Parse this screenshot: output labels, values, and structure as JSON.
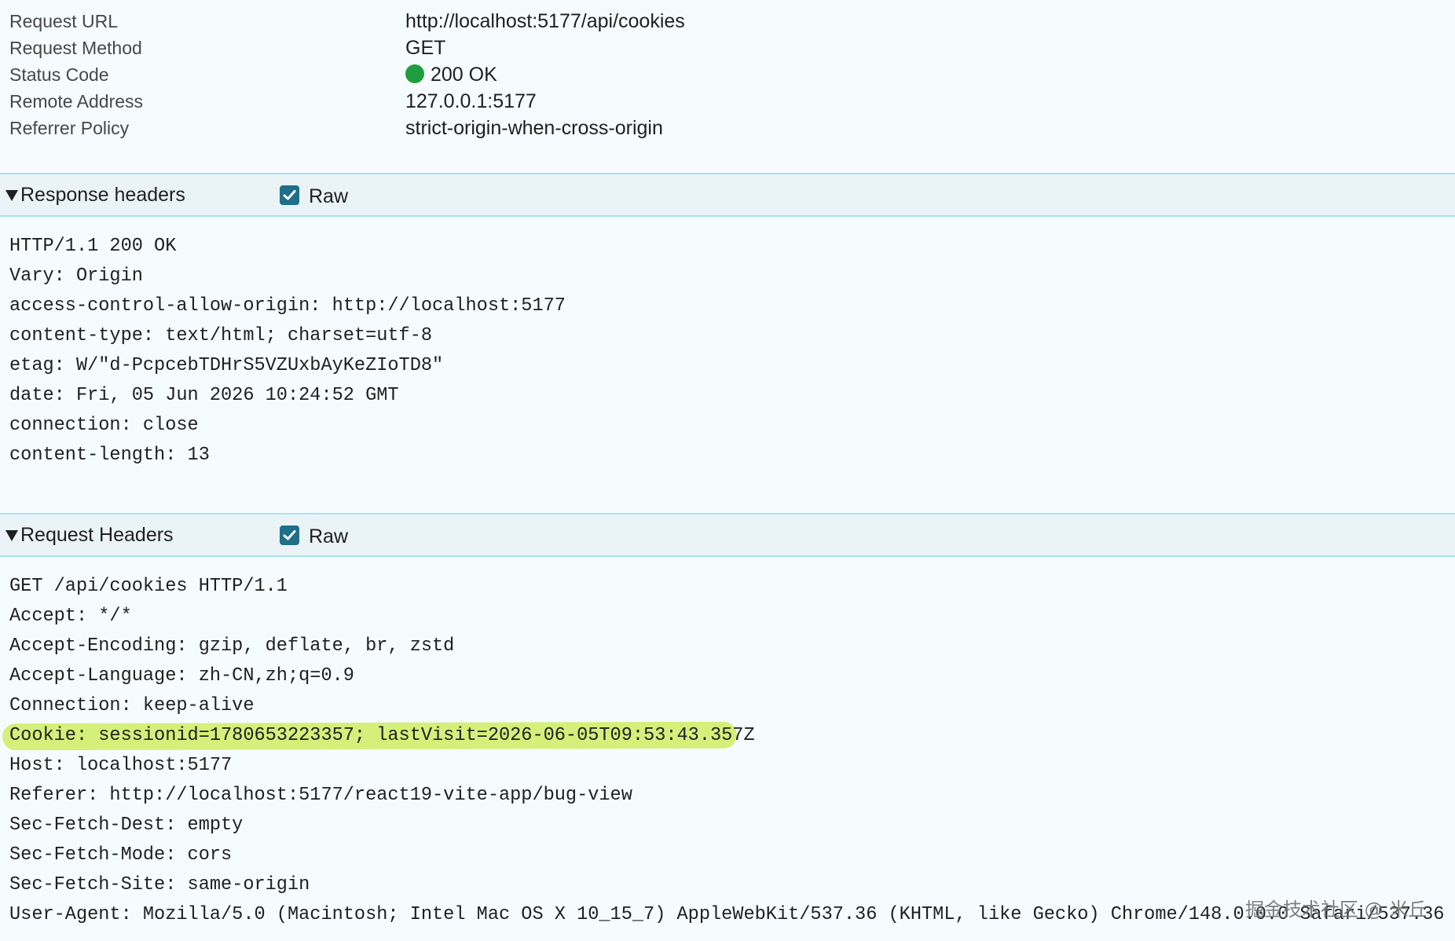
{
  "general": {
    "rows": [
      {
        "label": "Request URL",
        "value": "http://localhost:5177/api/cookies"
      },
      {
        "label": "Request Method",
        "value": "GET"
      },
      {
        "label": "Status Code",
        "value": "200 OK"
      },
      {
        "label": "Remote Address",
        "value": "127.0.0.1:5177"
      },
      {
        "label": "Referrer Policy",
        "value": "strict-origin-when-cross-origin"
      }
    ],
    "status_color": "#1e9e3e"
  },
  "response_headers": {
    "title": "Response headers",
    "raw_label": "Raw",
    "raw_checked": true,
    "lines": [
      "HTTP/1.1 200 OK",
      "Vary: Origin",
      "access-control-allow-origin: http://localhost:5177",
      "content-type: text/html; charset=utf-8",
      "etag: W/\"d-PcpcebTDHrS5VZUxbAyKeZIoTD8\"",
      "date: Fri, 05 Jun 2026 10:24:52 GMT",
      "connection: close",
      "content-length: 13"
    ]
  },
  "request_headers": {
    "title": "Request Headers",
    "raw_label": "Raw",
    "raw_checked": true,
    "lines": [
      "GET /api/cookies HTTP/1.1",
      "Accept: */*",
      "Accept-Encoding: gzip, deflate, br, zstd",
      "Accept-Language: zh-CN,zh;q=0.9",
      "Connection: keep-alive",
      "Cookie: sessionid=1780653223357; lastVisit=2026-06-05T09:53:43.357Z",
      "Host: localhost:5177",
      "Referer: http://localhost:5177/react19-vite-app/bug-view",
      "Sec-Fetch-Dest: empty",
      "Sec-Fetch-Mode: cors",
      "Sec-Fetch-Site: same-origin",
      "User-Agent: Mozilla/5.0 (Macintosh; Intel Mac OS X 10_15_7) AppleWebKit/537.36 (KHTML, like Gecko) Chrome/148.0.0.0 Safari/537.36"
    ],
    "highlighted_line": "Cookie: sessionid=1780653223357; lastVisit=2026-06-05T09:53:43.357Z",
    "highlight_color": "#d4f07a"
  },
  "watermark": "掘金技术社区 @ 米丘",
  "colors": {
    "section_border": "#a9e2ef",
    "checkbox": "#1f6f8b",
    "background": "#f6fbfe"
  }
}
